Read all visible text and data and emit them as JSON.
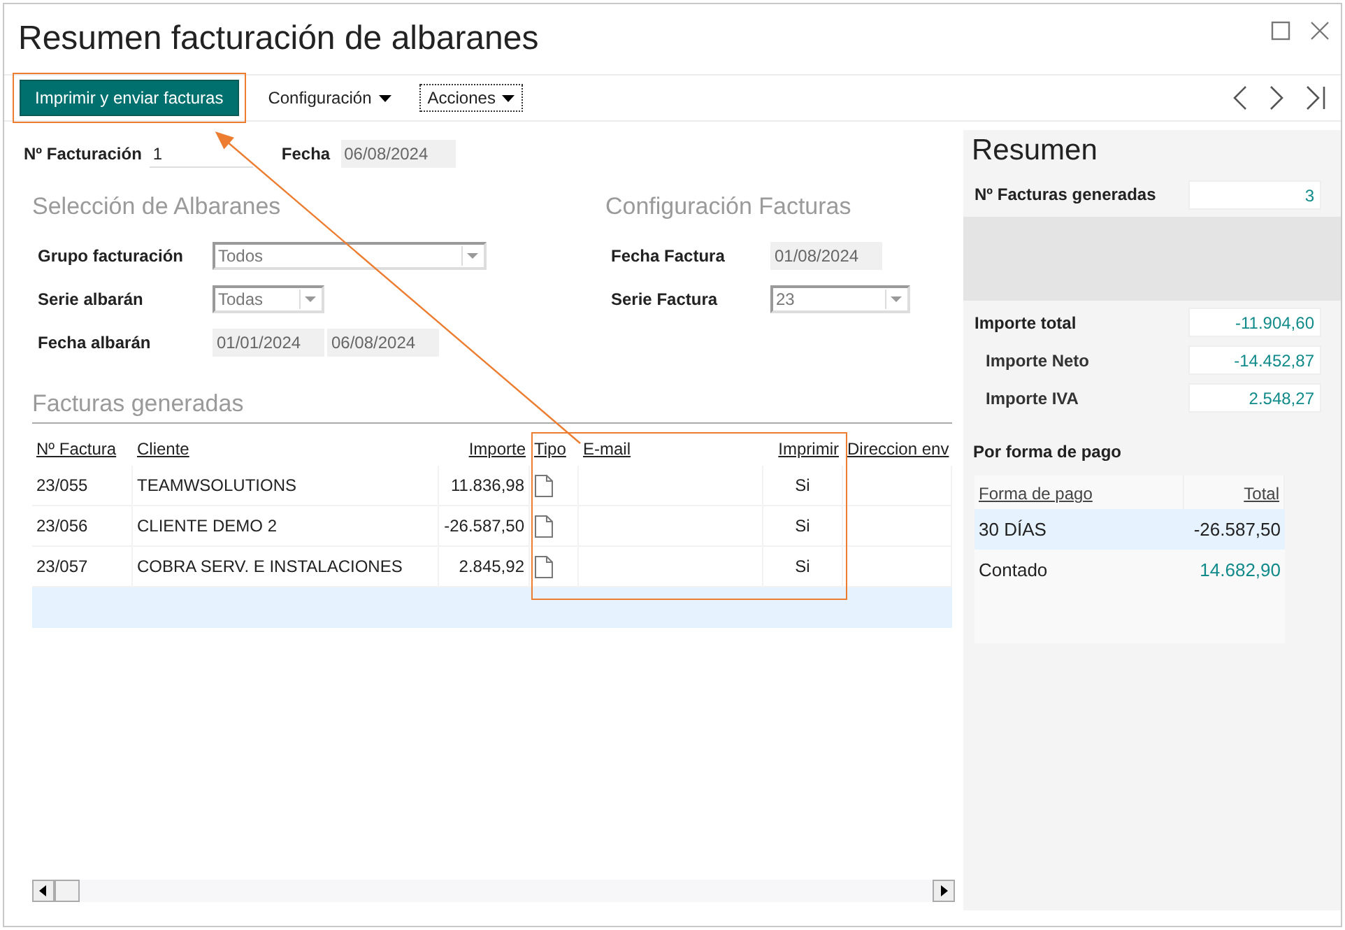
{
  "window": {
    "title": "Resumen facturación de albaranes"
  },
  "toolbar": [
    {
      "label": "Imprimir y enviar facturas",
      "kind": "primary",
      "highlighted": true
    },
    {
      "label": "Configuración",
      "kind": "menu",
      "focused": false
    },
    {
      "label": "Acciones",
      "kind": "menu",
      "focused": true
    }
  ],
  "header": {
    "facturacion": {
      "label": "Nº Facturación",
      "value": "1"
    },
    "fecha": {
      "label": "Fecha",
      "value": "06/08/2024"
    }
  },
  "seleccion": {
    "title": "Selección de Albaranes",
    "fields": [
      {
        "label": "Grupo facturación",
        "kind": "combo",
        "value": "Todos"
      },
      {
        "label": "Serie albarán",
        "kind": "combo",
        "value": "Todas"
      },
      {
        "label": "Fecha albarán",
        "kind": "range",
        "from": "01/01/2024",
        "to": "06/08/2024"
      }
    ]
  },
  "configuracion": {
    "title": "Configuración Facturas",
    "fields": [
      {
        "label": "Fecha Factura",
        "kind": "date",
        "value": "01/08/2024"
      },
      {
        "label": "Serie Factura",
        "kind": "combo",
        "value": "23"
      }
    ]
  },
  "facturas": {
    "title": "Facturas generadas",
    "columns": [
      {
        "label": "Nº Factura",
        "highlighted": false
      },
      {
        "label": "Cliente",
        "highlighted": false
      },
      {
        "label": "Importe",
        "highlighted": false
      },
      {
        "label": "Tipo",
        "highlighted": true
      },
      {
        "label": "E-mail",
        "highlighted": true
      },
      {
        "label": "Imprimir",
        "highlighted": true
      },
      {
        "label": "Direccion env",
        "highlighted": false
      }
    ],
    "rows": [
      {
        "numero": "23/055",
        "cliente": "TEAMWSOLUTIONS",
        "importe": "11.836,98",
        "imprimir": "Si",
        "selected": false
      },
      {
        "numero": "23/056",
        "cliente": "CLIENTE DEMO 2",
        "importe": "-26.587,50",
        "imprimir": "Si",
        "selected": false
      },
      {
        "numero": "23/057",
        "cliente": "COBRA SERV. E INSTALACIONES",
        "importe": "2.845,92",
        "imprimir": "Si",
        "selected": false
      }
    ],
    "blank_row": {
      "selected": true
    }
  },
  "resumen": {
    "title": "Resumen",
    "generadas": {
      "label": "Nº Facturas generadas",
      "value": "3"
    },
    "importes": [
      {
        "label": "Importe total",
        "value": "-11.904,60",
        "kind": "total"
      },
      {
        "label": "Importe Neto",
        "value": "-14.452,87",
        "kind": "sub"
      },
      {
        "label": "Importe IVA",
        "value": "2.548,27",
        "kind": "sub"
      }
    ],
    "pago": {
      "title": "Por forma de pago",
      "columns": [
        {
          "label": "Forma de pago"
        },
        {
          "label": "Total"
        }
      ],
      "rows": [
        {
          "forma": "30 DÍAS",
          "total": "-26.587,50",
          "selected": true
        },
        {
          "forma": "Contado",
          "total": "14.682,90",
          "selected": false
        }
      ]
    }
  }
}
